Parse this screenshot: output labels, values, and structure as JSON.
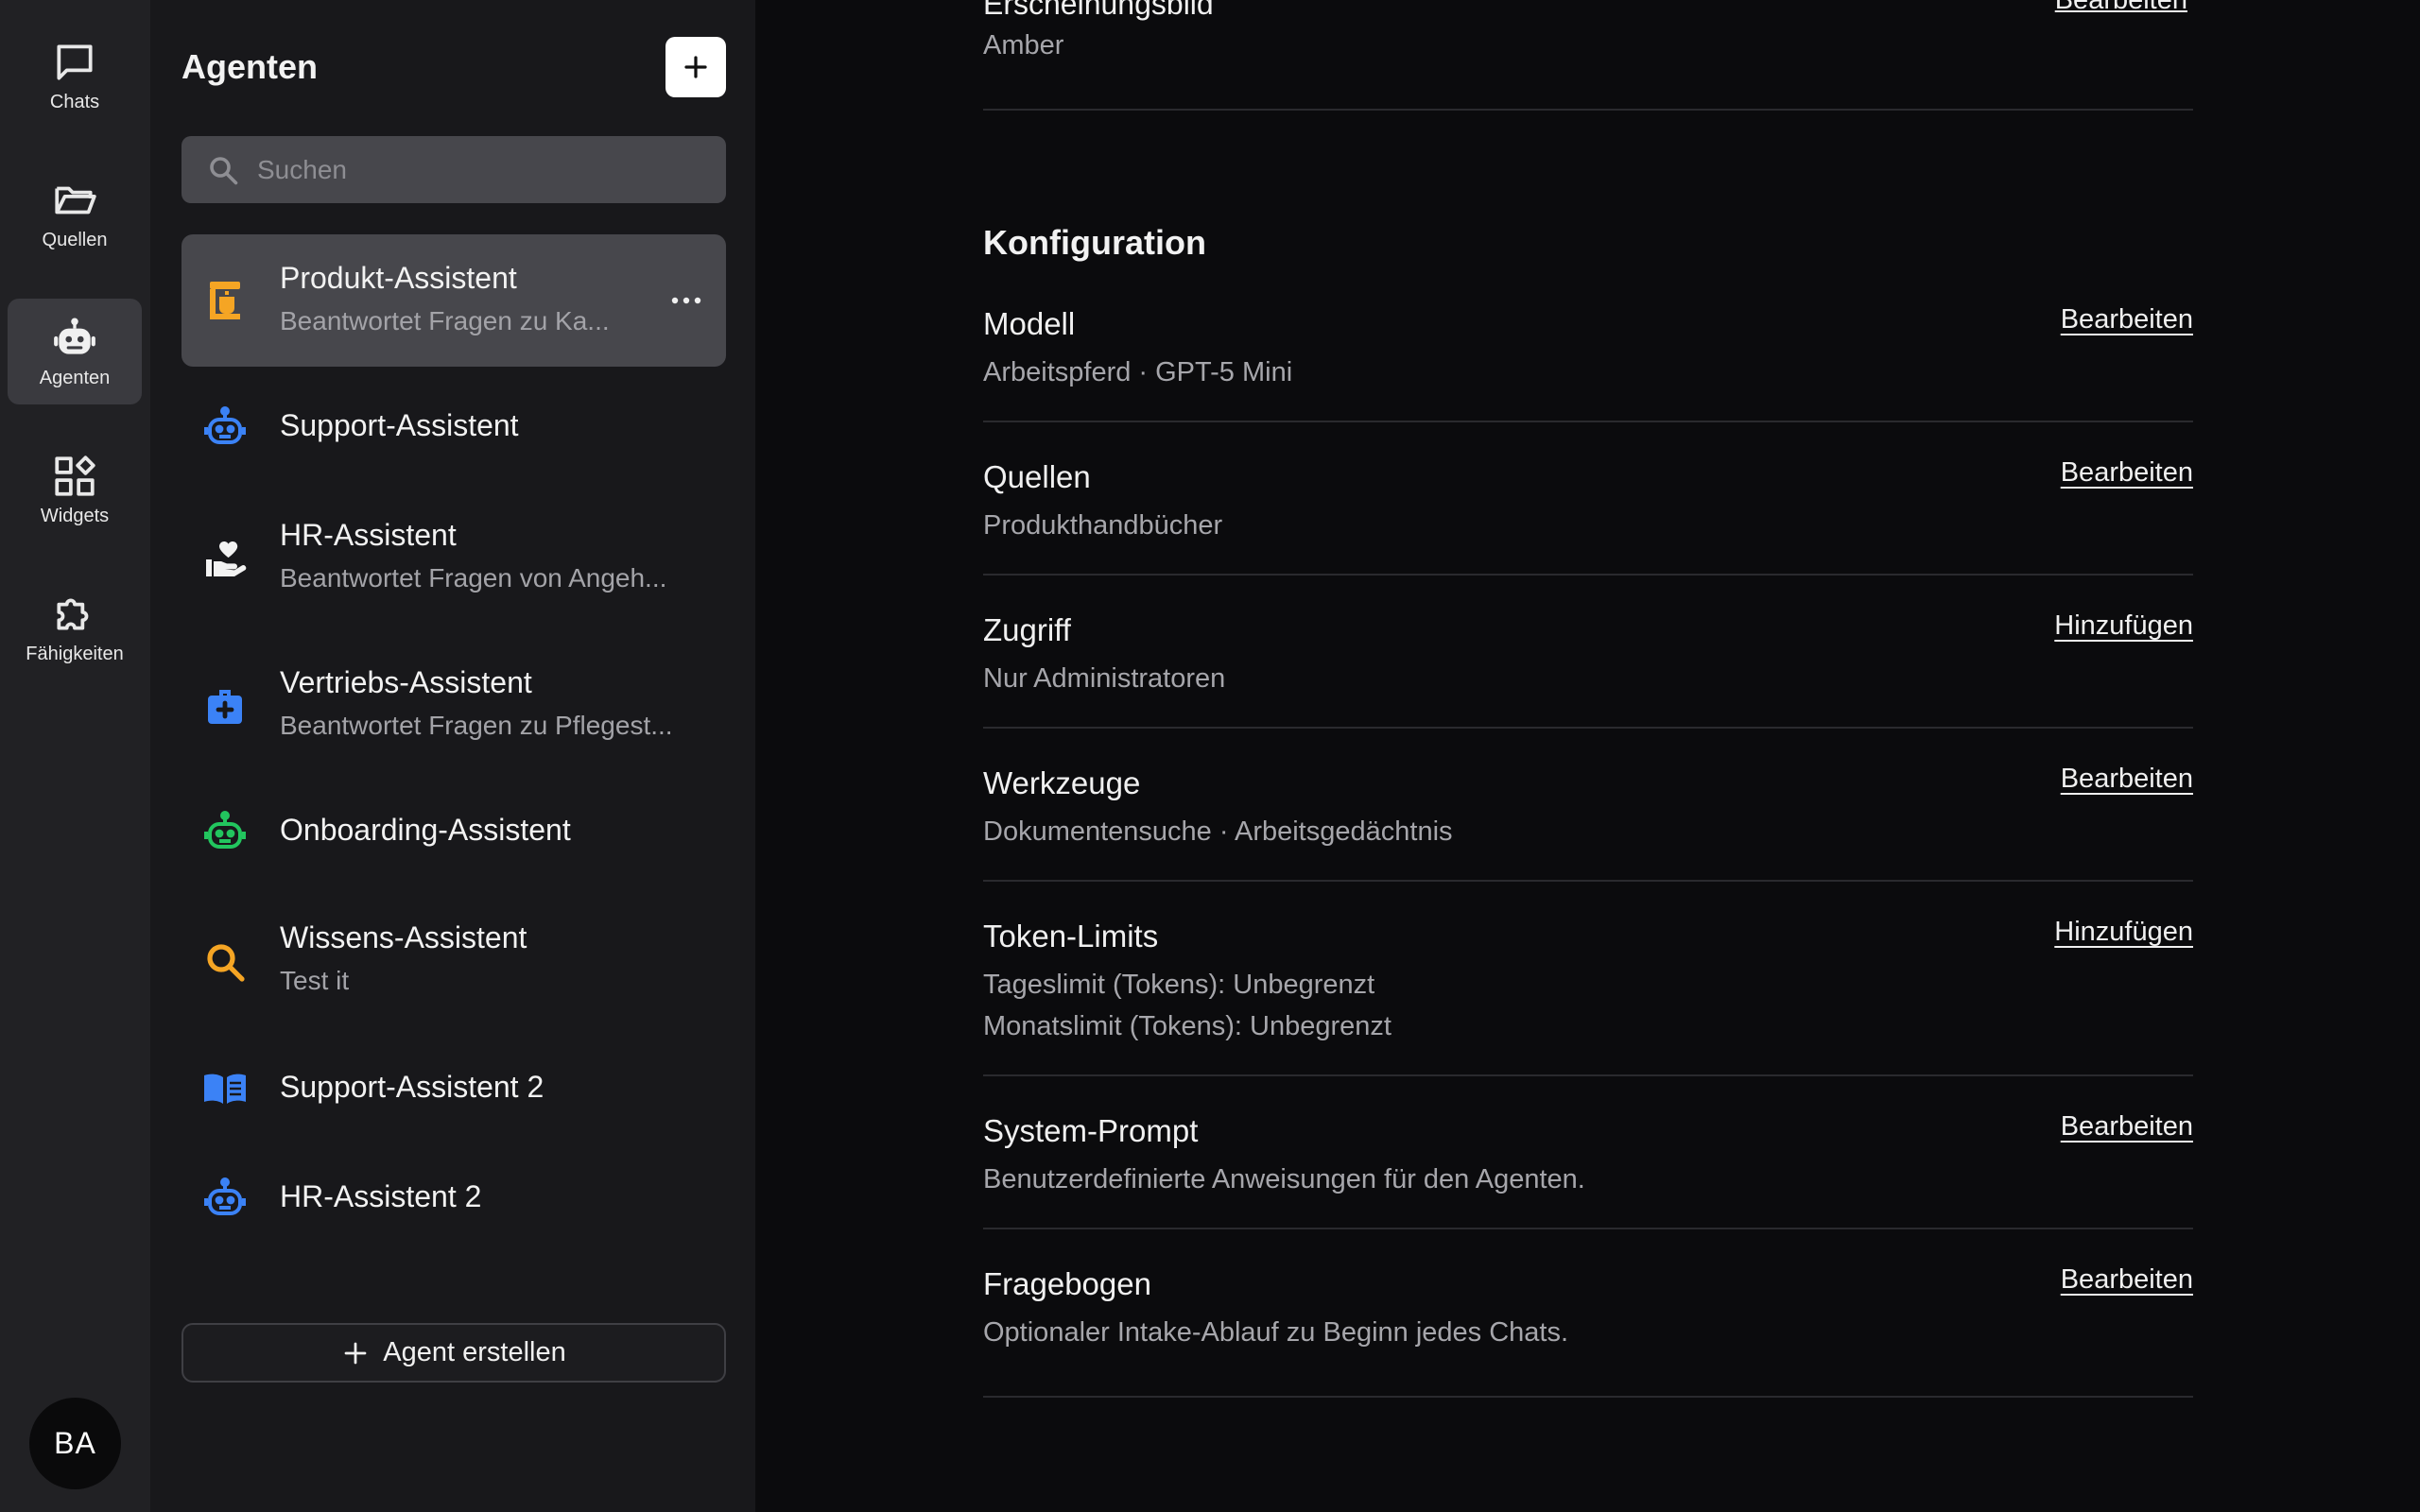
{
  "nav": {
    "items": [
      {
        "label": "Chats",
        "icon": "chat-icon"
      },
      {
        "label": "Quellen",
        "icon": "folder-icon"
      },
      {
        "label": "Agenten",
        "icon": "robot-icon",
        "active": true
      },
      {
        "label": "Widgets",
        "icon": "widgets-icon"
      },
      {
        "label": "Fähigkeiten",
        "icon": "puzzle-icon"
      }
    ],
    "avatar_initials": "BA"
  },
  "panel": {
    "title": "Agenten",
    "search_placeholder": "Suchen",
    "agents": [
      {
        "name": "Produkt-Assistent",
        "desc": "Beantwortet Fragen zu Ka...",
        "icon": "coffee-machine-icon",
        "color": "#f5a524",
        "active": true
      },
      {
        "name": "Support-Assistent",
        "desc": "",
        "icon": "robot-icon",
        "color": "#3b82f6"
      },
      {
        "name": "HR-Assistent",
        "desc": "Beantwortet Fragen von Angeh...",
        "icon": "hand-heart-icon",
        "color": "#f2f2f2"
      },
      {
        "name": "Vertriebs-Assistent",
        "desc": "Beantwortet Fragen zu Pflegest...",
        "icon": "medical-bag-icon",
        "color": "#3b82f6"
      },
      {
        "name": "Onboarding-Assistent",
        "desc": "",
        "icon": "robot-icon",
        "color": "#22c55e"
      },
      {
        "name": "Wissens-Assistent",
        "desc": "Test it",
        "icon": "search-icon",
        "color": "#f5a524"
      },
      {
        "name": "Support-Assistent 2",
        "desc": "",
        "icon": "book-icon",
        "color": "#3b82f6"
      },
      {
        "name": "HR-Assistent 2",
        "desc": "",
        "icon": "robot-icon",
        "color": "#3b82f6"
      }
    ],
    "create_label": "Agent erstellen"
  },
  "main": {
    "appearance": {
      "title": "Erscheinungsbild",
      "value": "Amber",
      "link": "Bearbeiten"
    },
    "section_title": "Konfiguration",
    "rows": [
      {
        "title": "Modell",
        "value": "Arbeitspferd · GPT-5 Mini",
        "link": "Bearbeiten"
      },
      {
        "title": "Quellen",
        "value": "Produkthandbücher",
        "link": "Bearbeiten"
      },
      {
        "title": "Zugriff",
        "value": "Nur Administratoren",
        "link": "Hinzufügen"
      },
      {
        "title": "Werkzeuge",
        "value": "Dokumentensuche · Arbeitsgedächtnis",
        "link": "Bearbeiten"
      },
      {
        "title": "Token-Limits",
        "value": "Tageslimit (Tokens): Unbegrenzt",
        "value2": "Monatslimit (Tokens): Unbegrenzt",
        "link": "Hinzufügen"
      },
      {
        "title": "System-Prompt",
        "value": "Benutzerdefinierte Anweisungen für den Agenten.",
        "link": "Bearbeiten"
      },
      {
        "title": "Fragebogen",
        "value": "Optionaler Intake-Ablauf zu Beginn jedes Chats.",
        "link": "Bearbeiten"
      }
    ]
  }
}
